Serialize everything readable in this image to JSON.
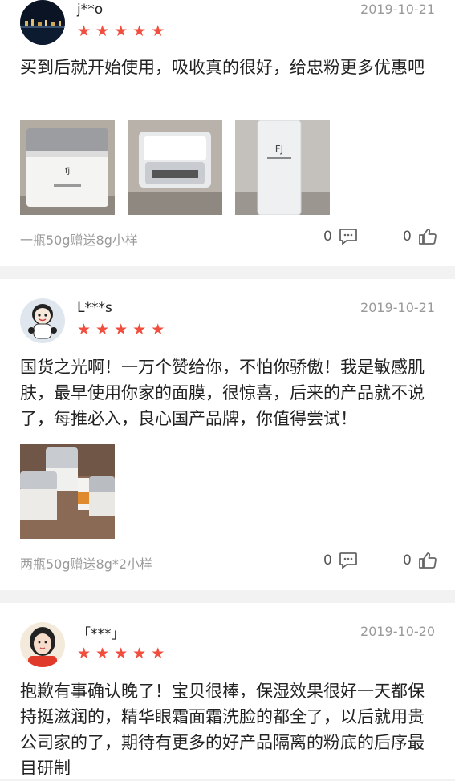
{
  "reviews": [
    {
      "username": "j**o",
      "date": "2019-10-21",
      "rating": 5,
      "text": "买到后就开始使用，吸收真的很好，给忠粉更多优惠吧",
      "variant": "一瓶50g赠送8g小样",
      "comments": "0",
      "likes": "0"
    },
    {
      "username": "L***s",
      "date": "2019-10-21",
      "rating": 5,
      "text": "国货之光啊！一万个赞给你，不怕你骄傲！我是敏感肌肤，最早使用你家的面膜，很惊喜，后来的产品就不说了，每推必入，良心国产品牌，你值得尝试！",
      "variant": "两瓶50g赠送8g*2小样",
      "comments": "0",
      "likes": "0"
    },
    {
      "username": "「***」",
      "date": "2019-10-20",
      "rating": 5,
      "text": "抱歉有事确认晚了！宝贝很棒，保湿效果很好一天都保持挺滋润的，精华眼霜面霜洗脸的都全了，以后就用贵公司家的了，期待有更多的好产品隔离的粉底的后序最目研制"
    }
  ],
  "icons": {
    "star": "star-icon",
    "comment": "comment-icon",
    "like": "thumbs-up-icon"
  },
  "colors": {
    "star": "#f04e3e",
    "date": "#9a9a9a",
    "text": "#222222",
    "divider": "#f2f2f2"
  }
}
